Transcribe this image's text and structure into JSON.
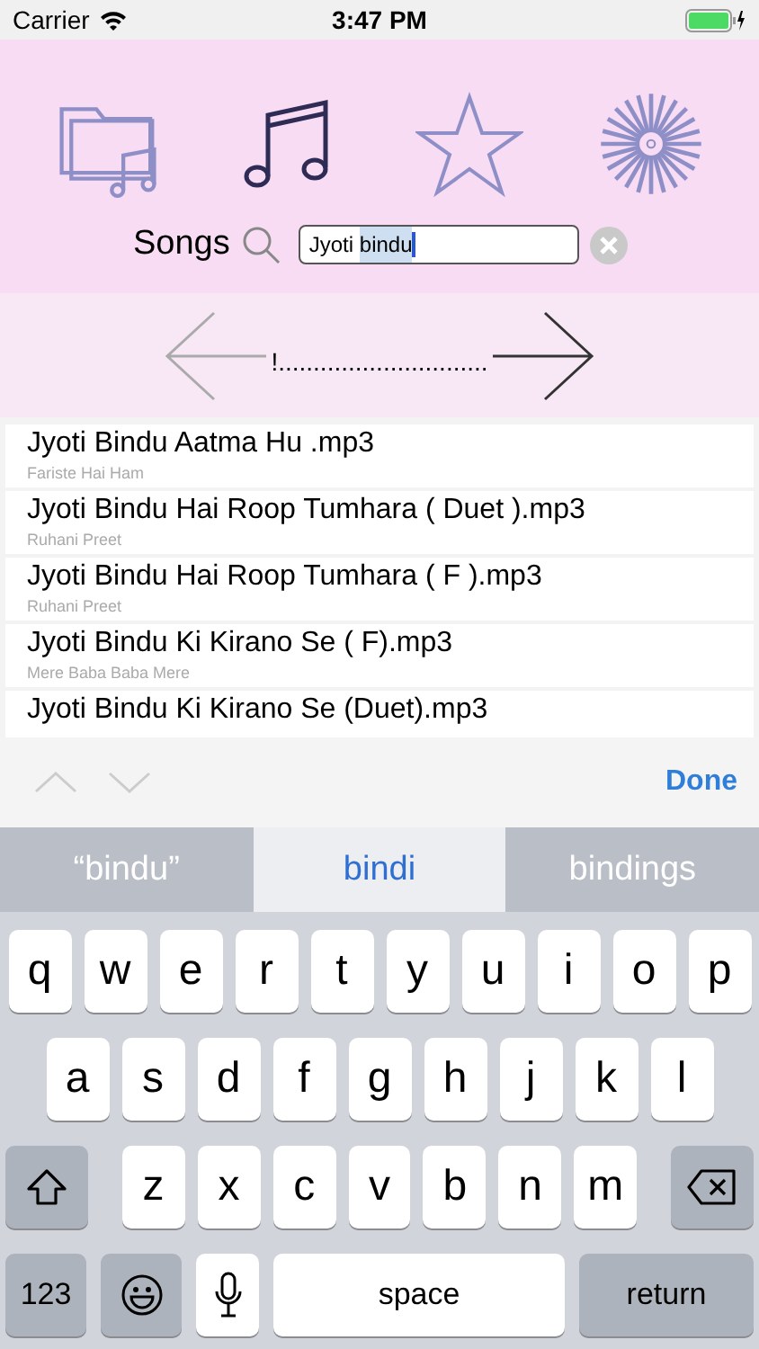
{
  "status_bar": {
    "carrier": "Carrier",
    "time": "3:47 PM"
  },
  "tabs": [
    {
      "kind": "folder",
      "selected": false
    },
    {
      "kind": "music",
      "selected": true
    },
    {
      "kind": "star",
      "selected": false
    },
    {
      "kind": "burst",
      "selected": false
    }
  ],
  "search": {
    "label": "Songs",
    "value": "Jyoti ",
    "marked": "bindu"
  },
  "pager": {
    "label": "!..............................",
    "prev_disabled": true,
    "next_disabled": false
  },
  "songs": [
    {
      "title": "Jyoti Bindu Aatma Hu .mp3",
      "album": "Fariste Hai Ham"
    },
    {
      "title": "Jyoti Bindu Hai Roop Tumhara ( Duet ).mp3",
      "album": "Ruhani Preet"
    },
    {
      "title": "Jyoti Bindu Hai Roop Tumhara ( F ).mp3",
      "album": "Ruhani Preet"
    },
    {
      "title": "Jyoti Bindu Ki Kirano Se ( F).mp3",
      "album": "Mere Baba Baba Mere"
    },
    {
      "title": "Jyoti Bindu Ki Kirano Se (Duet).mp3"
    }
  ],
  "accessory": {
    "done": "Done"
  },
  "suggestions": [
    {
      "label": "“bindu”",
      "selected": false
    },
    {
      "label": "bindi",
      "selected": true
    },
    {
      "label": "bindings",
      "selected": false
    }
  ],
  "keyboard": [
    [
      {
        "kind": "letter",
        "label": "q"
      },
      {
        "kind": "letter",
        "label": "w"
      },
      {
        "kind": "letter",
        "label": "e"
      },
      {
        "kind": "letter",
        "label": "r"
      },
      {
        "kind": "letter",
        "label": "t"
      },
      {
        "kind": "letter",
        "label": "y"
      },
      {
        "kind": "letter",
        "label": "u"
      },
      {
        "kind": "letter",
        "label": "i"
      },
      {
        "kind": "letter",
        "label": "o"
      },
      {
        "kind": "letter",
        "label": "p"
      }
    ],
    [
      {
        "kind": "letter",
        "label": "a"
      },
      {
        "kind": "letter",
        "label": "s"
      },
      {
        "kind": "letter",
        "label": "d"
      },
      {
        "kind": "letter",
        "label": "f"
      },
      {
        "kind": "letter",
        "label": "g"
      },
      {
        "kind": "letter",
        "label": "h"
      },
      {
        "kind": "letter",
        "label": "j"
      },
      {
        "kind": "letter",
        "label": "k"
      },
      {
        "kind": "letter",
        "label": "l"
      }
    ],
    [
      {
        "kind": "shift"
      },
      {
        "kind": "letter",
        "label": "z"
      },
      {
        "kind": "letter",
        "label": "x"
      },
      {
        "kind": "letter",
        "label": "c"
      },
      {
        "kind": "letter",
        "label": "v"
      },
      {
        "kind": "letter",
        "label": "b"
      },
      {
        "kind": "letter",
        "label": "n"
      },
      {
        "kind": "letter",
        "label": "m"
      },
      {
        "kind": "delete"
      }
    ],
    [
      {
        "kind": "numbers",
        "label": "123"
      },
      {
        "kind": "emoji"
      },
      {
        "kind": "mic"
      },
      {
        "kind": "space",
        "label": "space"
      },
      {
        "kind": "return",
        "label": "return"
      }
    ]
  ]
}
